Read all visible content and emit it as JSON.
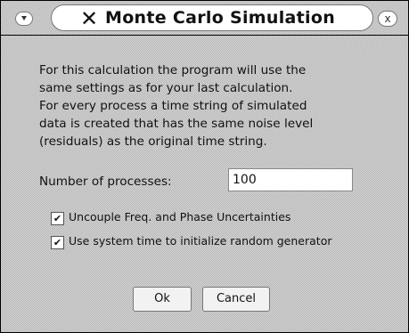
{
  "window": {
    "title": "Monte Carlo Simulation",
    "title_icon": "x-logo-icon",
    "close_glyph": "x"
  },
  "description": "For this calculation the program will use the\nsame settings as for your last calculation.\nFor every process a time string of simulated\ndata is created that has the same noise level\n(residuals) as the original time string.",
  "processes": {
    "label": "Number of processes:",
    "value": "100"
  },
  "options": [
    {
      "label": "Uncouple Freq. and Phase Uncertainties",
      "checked": true
    },
    {
      "label": "Use system time to initialize random generator",
      "checked": true
    }
  ],
  "buttons": {
    "ok": "Ok",
    "cancel": "Cancel"
  }
}
